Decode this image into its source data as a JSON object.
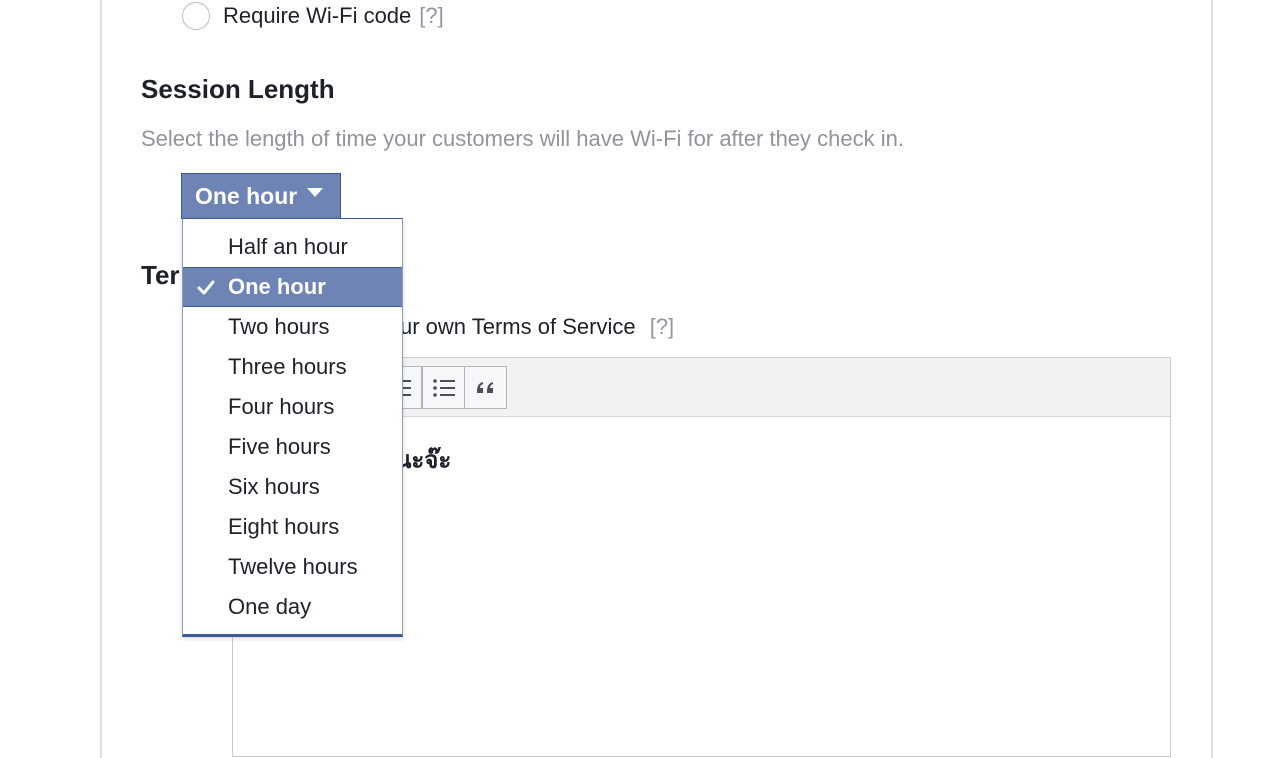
{
  "wifi_option": {
    "label": "Require Wi-Fi code",
    "help": "[?]"
  },
  "session": {
    "heading": "Session Length",
    "description": "Select the length of time your customers will have Wi-Fi for after they check in.",
    "selected_label": "One hour",
    "options": [
      {
        "label": "Half an hour",
        "selected": false
      },
      {
        "label": "One hour",
        "selected": true
      },
      {
        "label": "Two hours",
        "selected": false
      },
      {
        "label": "Three hours",
        "selected": false
      },
      {
        "label": "Four hours",
        "selected": false
      },
      {
        "label": "Five hours",
        "selected": false
      },
      {
        "label": "Six hours",
        "selected": false
      },
      {
        "label": "Eight hours",
        "selected": false
      },
      {
        "label": "Twelve hours",
        "selected": false
      },
      {
        "label": "One day",
        "selected": false
      }
    ]
  },
  "terms": {
    "heading_partial": "Ter",
    "label_partial": "ur own Terms of Service",
    "help": "[?]",
    "editor_text_partial": "นะจ๊ะ",
    "toolbar_icons": [
      "numbered-list-icon",
      "bulleted-list-icon",
      "quote-icon"
    ]
  },
  "colors": {
    "accent": "#6d84b4",
    "accent_border": "#3b5998",
    "muted_text": "#90949c",
    "help_text": "#9197a3"
  }
}
